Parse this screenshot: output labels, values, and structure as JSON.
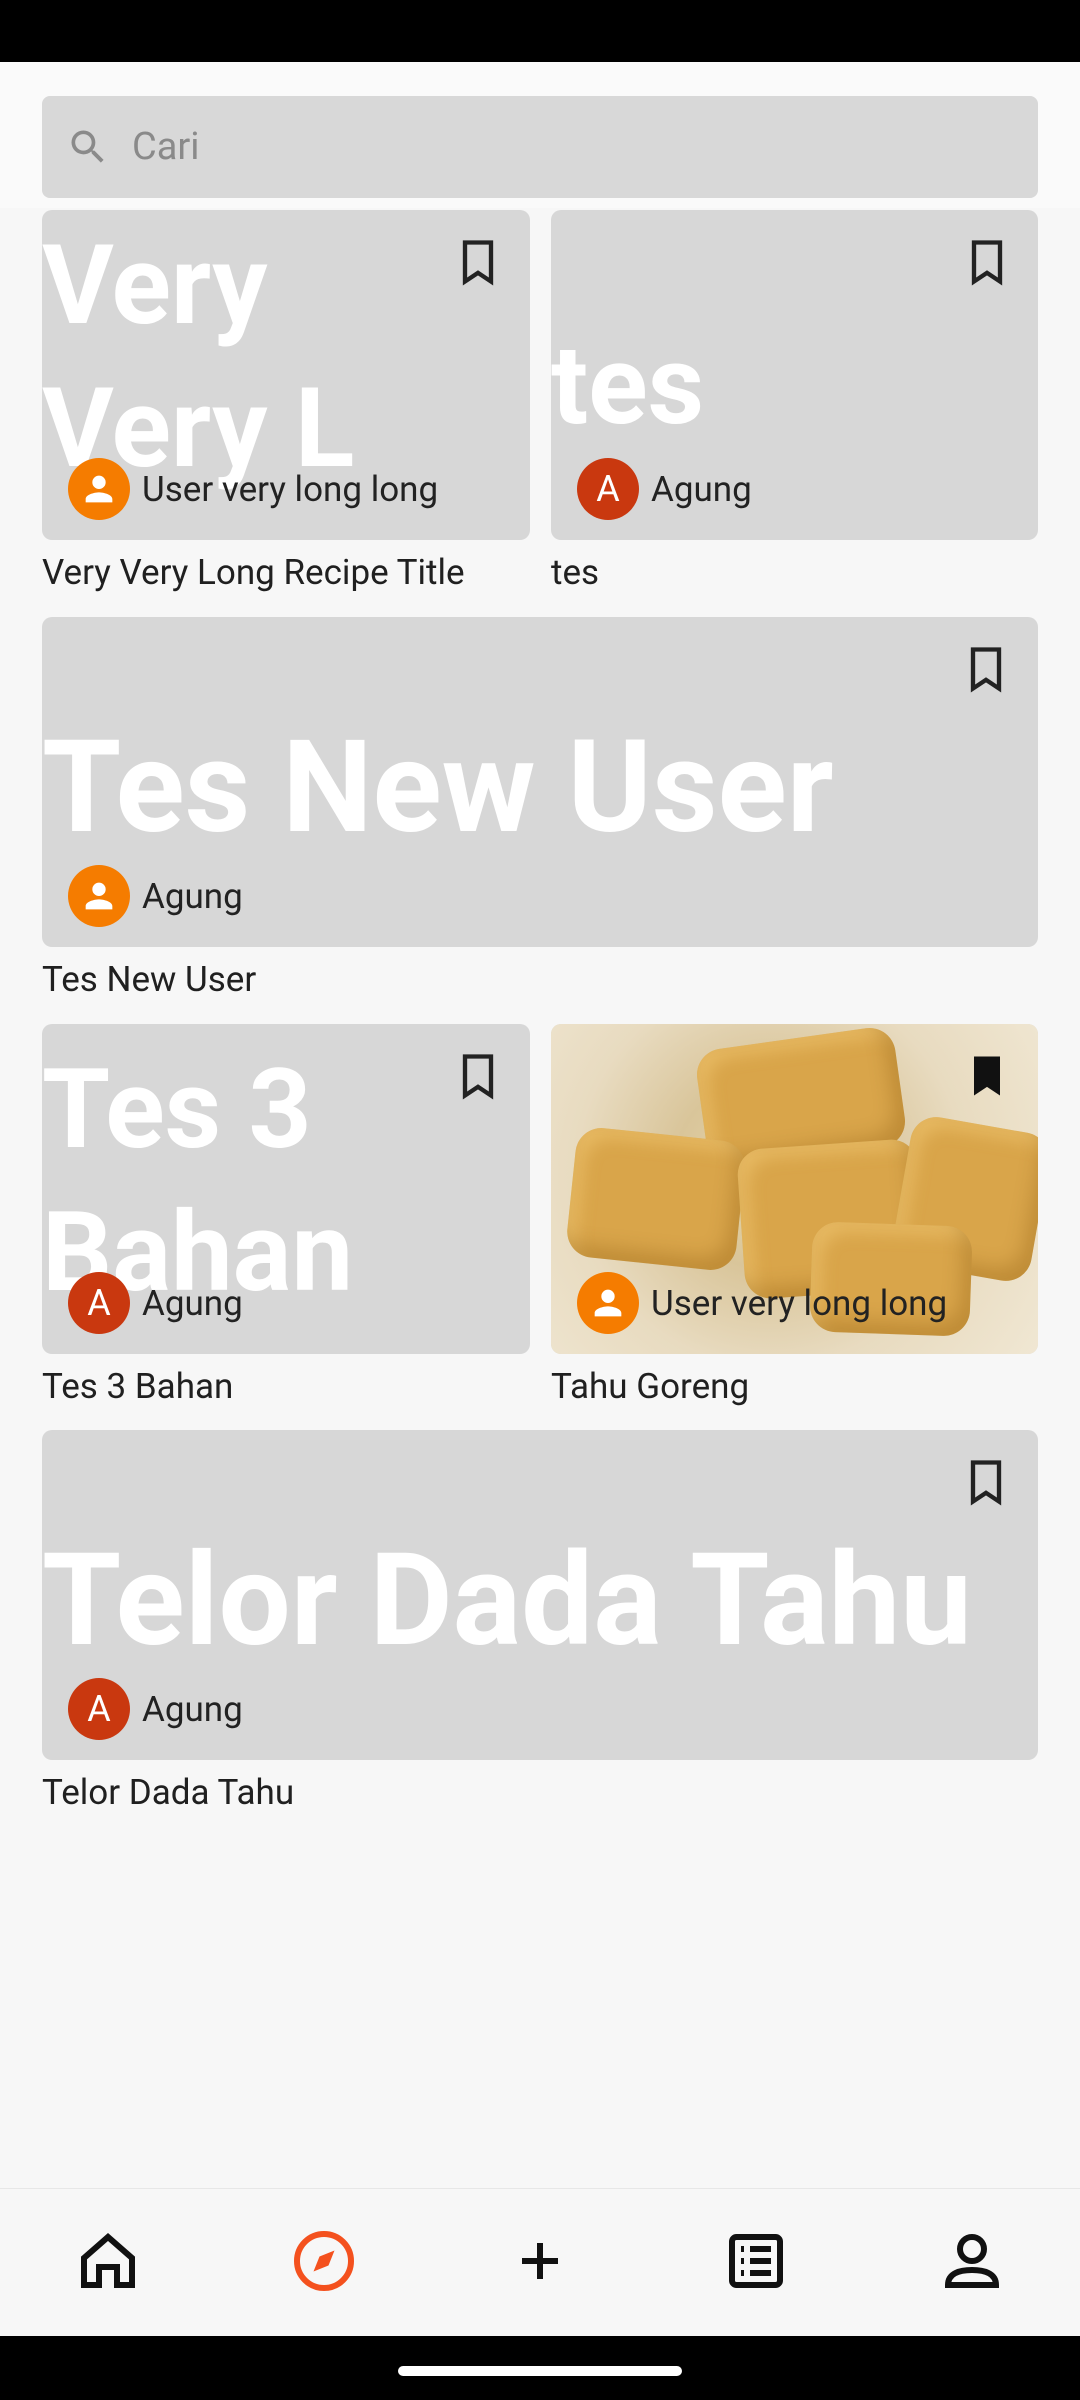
{
  "search": {
    "placeholder": "Cari"
  },
  "recipes": [
    {
      "overlay_title": "Very Very L",
      "author_name": "User very long long",
      "label": "Very Very Long Recipe Title"
    },
    {
      "overlay_title": "tes",
      "author_name": "Agung",
      "author_initial": "A",
      "label": "tes"
    },
    {
      "overlay_title": "Tes New User",
      "author_name": "Agung",
      "label": "Tes New User"
    },
    {
      "overlay_title": "Tes 3 Bahan",
      "author_name": "Agung",
      "author_initial": "A",
      "label": "Tes 3 Bahan"
    },
    {
      "author_name": "User very long long",
      "label": "Tahu Goreng",
      "bookmarked": true
    },
    {
      "overlay_title": "Telor Dada Tahu",
      "author_name": "Agung",
      "author_initial": "A",
      "label": "Telor Dada Tahu"
    }
  ],
  "nav": {
    "items": [
      "home-icon",
      "explore-icon",
      "add-icon",
      "list-icon",
      "profile-icon"
    ],
    "active": "explore-icon"
  },
  "colors": {
    "accent": "#f4511e",
    "avatar_person": "#f57c00",
    "avatar_letter": "#c9380f",
    "card_bg": "#d7d7d7"
  }
}
